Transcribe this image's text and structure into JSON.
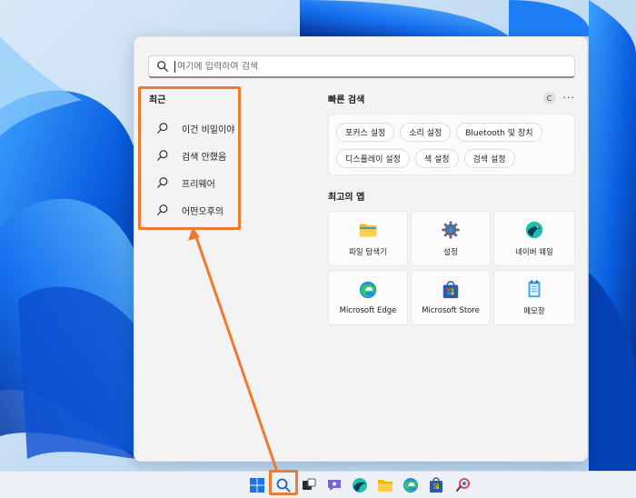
{
  "search": {
    "placeholder": "여기에 입력하여 검색"
  },
  "recent": {
    "title": "최근",
    "items": [
      {
        "label": "이건 비밀이야"
      },
      {
        "label": "검색 안했음"
      },
      {
        "label": "프리웨어"
      },
      {
        "label": "어떤오후의"
      }
    ]
  },
  "quick_search": {
    "title": "빠른 검색",
    "badge": "C",
    "more_label": "···",
    "chips": [
      {
        "label": "포커스 설정"
      },
      {
        "label": "소리 설정"
      },
      {
        "label": "Bluetooth 및 장치"
      },
      {
        "label": "디스플레이 설정"
      },
      {
        "label": "색 설정"
      },
      {
        "label": "검색 설정"
      }
    ]
  },
  "top_apps": {
    "title": "최고의 앱",
    "apps": [
      {
        "label": "파일 탐색기",
        "icon": "folder-icon"
      },
      {
        "label": "설정",
        "icon": "gear-icon"
      },
      {
        "label": "네이버 웨일",
        "icon": "whale-browser-icon"
      },
      {
        "label": "Microsoft Edge",
        "icon": "edge-icon"
      },
      {
        "label": "Microsoft Store",
        "icon": "store-icon"
      },
      {
        "label": "메모장",
        "icon": "notepad-icon"
      }
    ]
  },
  "taskbar": {
    "icons": [
      "windows-start-icon",
      "search-icon",
      "task-view-icon",
      "chat-icon",
      "whale-browser-icon",
      "file-explorer-icon",
      "edge-icon",
      "store-icon",
      "snipping-tool-icon"
    ]
  },
  "colors": {
    "highlight": "#ee7a2f",
    "accent": "#0067c0"
  }
}
